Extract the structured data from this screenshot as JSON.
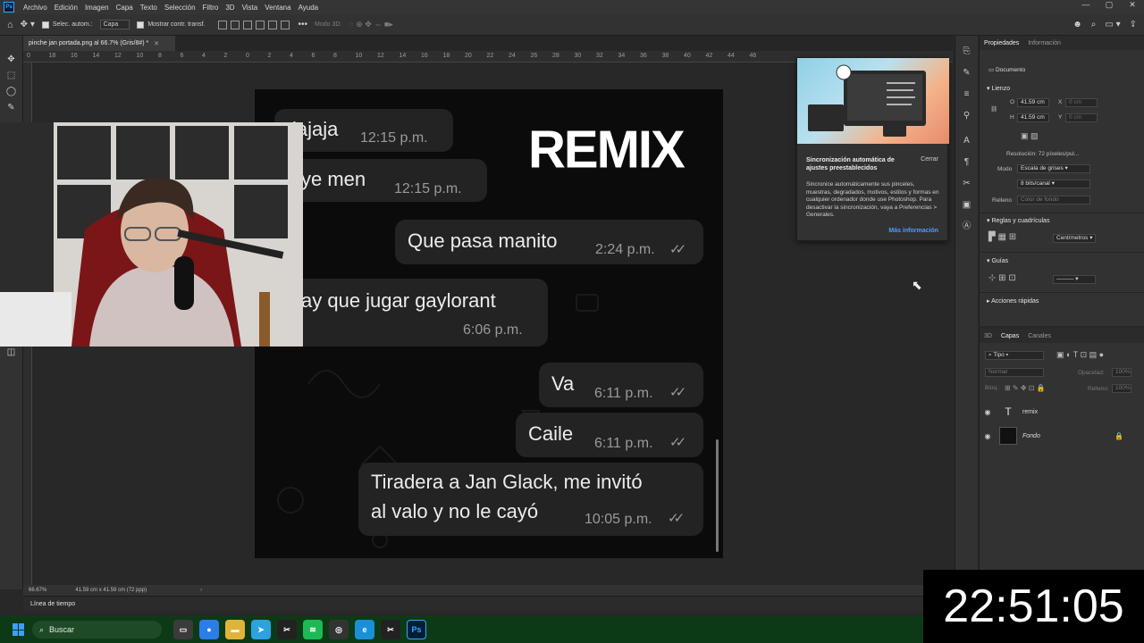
{
  "menu": {
    "app_icon": "Ps",
    "items": [
      "Archivo",
      "Edición",
      "Imagen",
      "Capa",
      "Texto",
      "Selección",
      "Filtro",
      "3D",
      "Vista",
      "Ventana",
      "Ayuda"
    ]
  },
  "options_bar": {
    "auto_select_label": "Selec. autom.:",
    "auto_select_value": "Capa",
    "show_transform_label": "Mostrar contr. transf.",
    "mode_3d_label": "Modo 3D:"
  },
  "document_tab": {
    "title": "pinche jan portada.png al 66.7% (Gris/8#) *"
  },
  "ruler_ticks": [
    "0",
    "18",
    "16",
    "14",
    "12",
    "10",
    "8",
    "6",
    "4",
    "2",
    "0",
    "2",
    "4",
    "6",
    "8",
    "10",
    "12",
    "14",
    "16",
    "18",
    "20",
    "22",
    "24",
    "26",
    "28",
    "30",
    "32",
    "34",
    "36",
    "38",
    "40",
    "42",
    "44",
    "46"
  ],
  "artboard": {
    "remix_title": "REMIX",
    "messages": [
      {
        "text": "jajaja",
        "time": "12:15 p.m.",
        "outgoing": false
      },
      {
        "text": "ye men",
        "time": "12:15 p.m.",
        "outgoing": false
      },
      {
        "text": "Que pasa manito",
        "time": "2:24 p.m.",
        "outgoing": true
      },
      {
        "text": "ay que jugar gaylorant",
        "time": "6:06 p.m.",
        "outgoing": false
      },
      {
        "text": "Va",
        "time": "6:11 p.m.",
        "outgoing": true
      },
      {
        "text": "Caile",
        "time": "6:11 p.m.",
        "outgoing": true
      },
      {
        "text_line1": "Tiradera a Jan Glack, me invitó",
        "text_line2": "al valo y no le cayó",
        "time": "10:05 p.m.",
        "outgoing": true
      }
    ],
    "ticks_glyph": "✓✓"
  },
  "status": {
    "zoom": "66.67%",
    "doc_size": "41.59 cm x 41.59 cm (72 ppp)",
    "timeline_label": "Línea de tiempo"
  },
  "sync_popup": {
    "title": "Sincronización automática de ajustes preestablecidos",
    "close_label": "Cerrar",
    "body": "Sincronice automáticamente sus pinceles, muestras, degradados, motivos, estilos y formas en cualquier ordenador donde use Photoshop. Para desactivar la sincronización, vaya a Preferencias > Generales.",
    "more_link": "Más información"
  },
  "properties": {
    "tabs": [
      "Propiedades",
      "Información"
    ],
    "doc_label": "Documento",
    "canvas_section": "Lienzo",
    "w_label": "O",
    "w_value": "41.59 cm",
    "x_label": "X",
    "x_value": "0 cm",
    "h_label": "H",
    "h_value": "41.59 cm",
    "y_label": "Y",
    "y_value": "0 cm",
    "resolution": "Resolución: 72 píxeles/pul...",
    "mode_label": "Modo",
    "mode_value": "Escala de grises",
    "depth_value": "8 bits/canal",
    "fill_label": "Relleno",
    "fill_value": "Color de fondo",
    "rulers_section": "Reglas y cuadrículas",
    "units_value": "Centímetros",
    "guides_section": "Guías",
    "quick_actions": "Acciones rápidas"
  },
  "layers": {
    "tabs": [
      "3D",
      "Capas",
      "Canales"
    ],
    "filter_label": "Tipo",
    "blend_mode": "Normal",
    "opacity_label": "Opacidad:",
    "opacity_value": "100%",
    "lock_label": "Bloq.:",
    "fill_label": "Relleno:",
    "fill_value": "100%",
    "items": [
      {
        "name": "remix",
        "type": "text"
      },
      {
        "name": "Fondo",
        "type": "image"
      }
    ]
  },
  "clock": "22:51:05",
  "taskbar": {
    "search_label": "Buscar",
    "apps": [
      {
        "name": "file-explorer-tasks",
        "glyph": "▭",
        "color": "#3b3b3b"
      },
      {
        "name": "chrome",
        "glyph": "●",
        "color": "#2b7de9"
      },
      {
        "name": "folder",
        "glyph": "▬",
        "color": "#e0b43a"
      },
      {
        "name": "telegram",
        "glyph": "➤",
        "color": "#2aa3e0"
      },
      {
        "name": "capcut",
        "glyph": "✂",
        "color": "#222222"
      },
      {
        "name": "spotify",
        "glyph": "≋",
        "color": "#1db954"
      },
      {
        "name": "obs",
        "glyph": "◎",
        "color": "#333333"
      },
      {
        "name": "edge",
        "glyph": "e",
        "color": "#1a8fd8"
      },
      {
        "name": "capcut-2",
        "glyph": "✂",
        "color": "#222222"
      },
      {
        "name": "photoshop",
        "glyph": "Ps",
        "color": "#001e36"
      }
    ]
  }
}
